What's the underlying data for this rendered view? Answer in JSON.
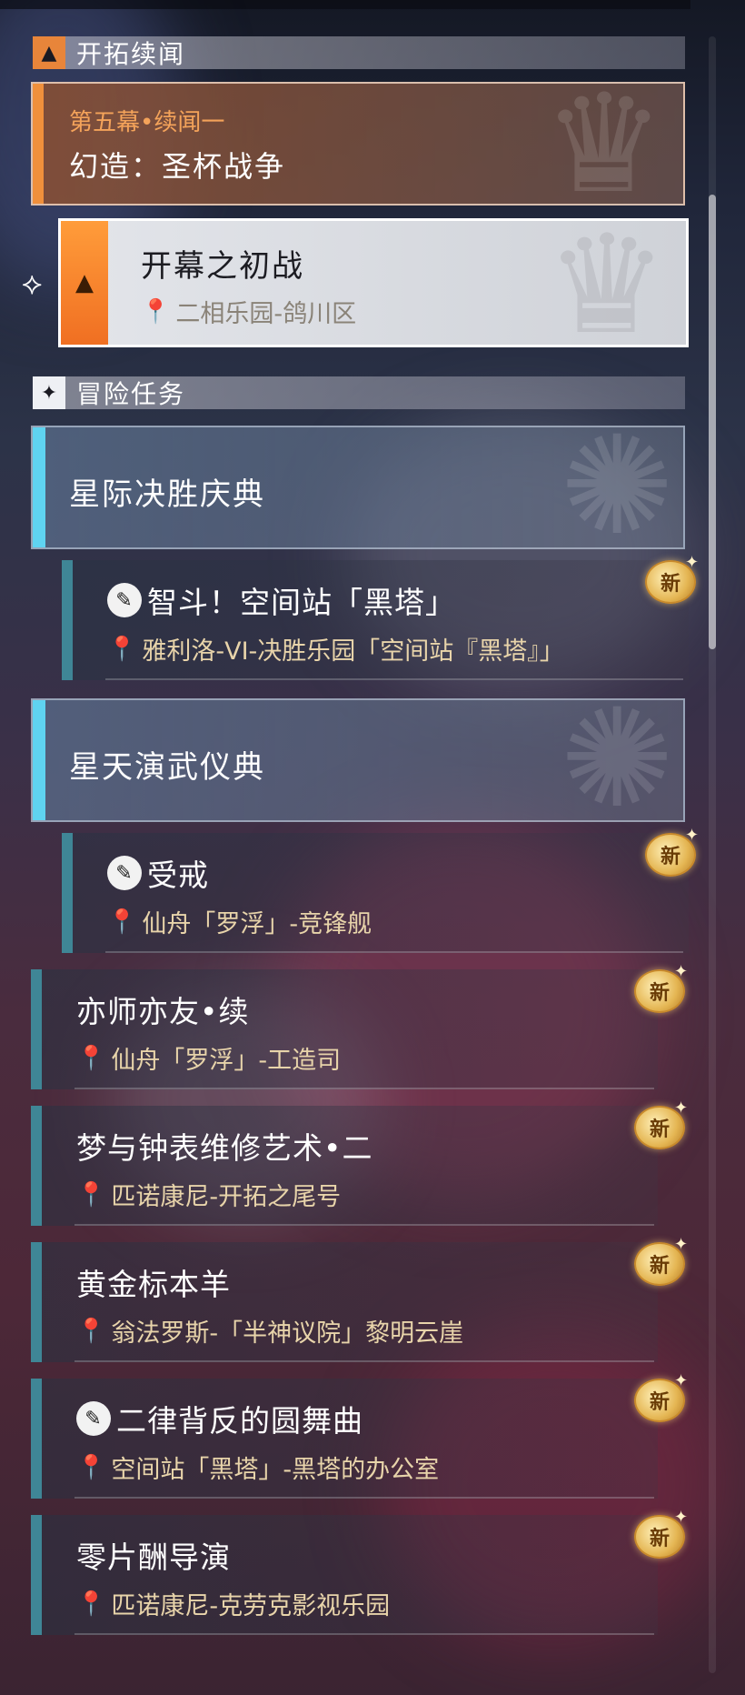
{
  "sections": {
    "trailblaze": {
      "icon": "trailblaze-triangle-icon",
      "title": "开拓续闻"
    },
    "adventure": {
      "icon": "adventure-star-icon",
      "title": "冒险任务"
    }
  },
  "chapter": {
    "subtitle": "第五幕•续闻一",
    "title": "幻造：圣杯战争"
  },
  "active_quest": {
    "title": "开幕之初战",
    "location": "二相乐园-鸽川区"
  },
  "events": [
    {
      "title": "星际决胜庆典",
      "quest": {
        "title": "智斗！空间站「黑塔」",
        "location": "雅利洛-VI-决胜乐园「空间站『黑塔』」",
        "badge": "新"
      }
    },
    {
      "title": "星天演武仪典",
      "quest": {
        "title": "受戒",
        "location": "仙舟「罗浮」-竞锋舰",
        "badge": "新"
      }
    }
  ],
  "quests": [
    {
      "title": "亦师亦友•续",
      "location": "仙舟「罗浮」-工造司",
      "badge": "新",
      "has_icon": false
    },
    {
      "title": "梦与钟表维修艺术•二",
      "location": "匹诺康尼-开拓之尾号",
      "badge": "新",
      "has_icon": false
    },
    {
      "title": "黄金标本羊",
      "location": "翁法罗斯-「半神议院」黎明云崖",
      "badge": "新",
      "has_icon": false
    },
    {
      "title": "二律背反的圆舞曲",
      "location": "空间站「黑塔」-黑塔的办公室",
      "badge": "新",
      "has_icon": true
    },
    {
      "title": "零片酬导演",
      "location": "匹诺康尼-克劳克影视乐园",
      "badge": "新",
      "has_icon": false
    }
  ],
  "colors": {
    "trailblaze_accent": "#f0903c",
    "event_accent": "#5fd3f0",
    "quest_bar": "#3f8696",
    "location_text": "#e8d4aa",
    "new_badge": "#e4b552"
  }
}
